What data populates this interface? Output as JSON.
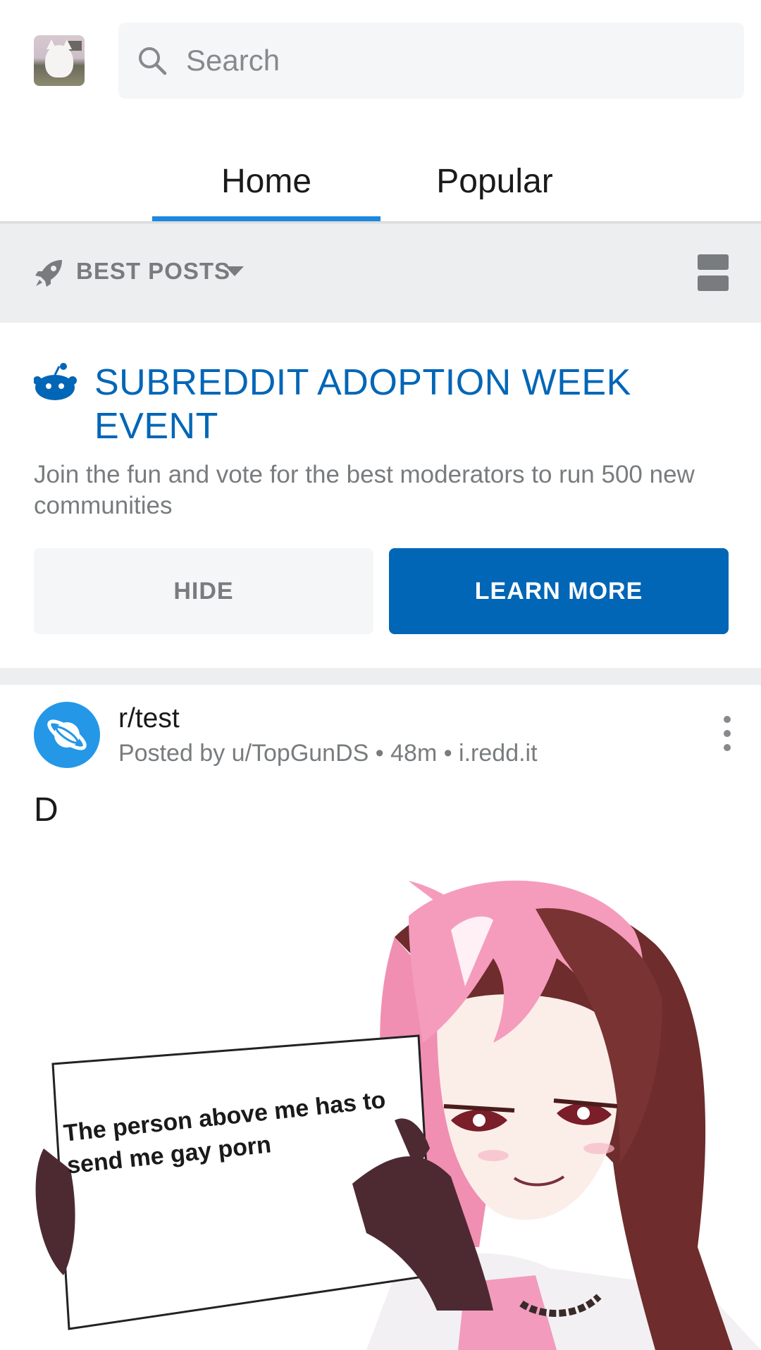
{
  "search": {
    "placeholder": "Search"
  },
  "tabs": [
    {
      "label": "Home",
      "active": true
    },
    {
      "label": "Popular",
      "active": false
    }
  ],
  "sort": {
    "label": "BEST POSTS"
  },
  "event": {
    "title": "SUBREDDIT ADOPTION WEEK EVENT",
    "description": "Join the fun and vote for the best moderators to run 500 new communities",
    "hide_label": "HIDE",
    "learn_more_label": "LEARN MORE"
  },
  "post": {
    "subreddit": "r/test",
    "meta": "Posted by u/TopGunDS • 48m • i.redd.it",
    "title": "D",
    "image_sign_text": "The person above me has to send me gay porn"
  },
  "colors": {
    "accent": "#0266b7",
    "tab_indicator": "#1d88e0",
    "subreddit_icon": "#2497e7",
    "muted_text": "#787c7e",
    "sort_bar_bg": "#edeef0"
  }
}
